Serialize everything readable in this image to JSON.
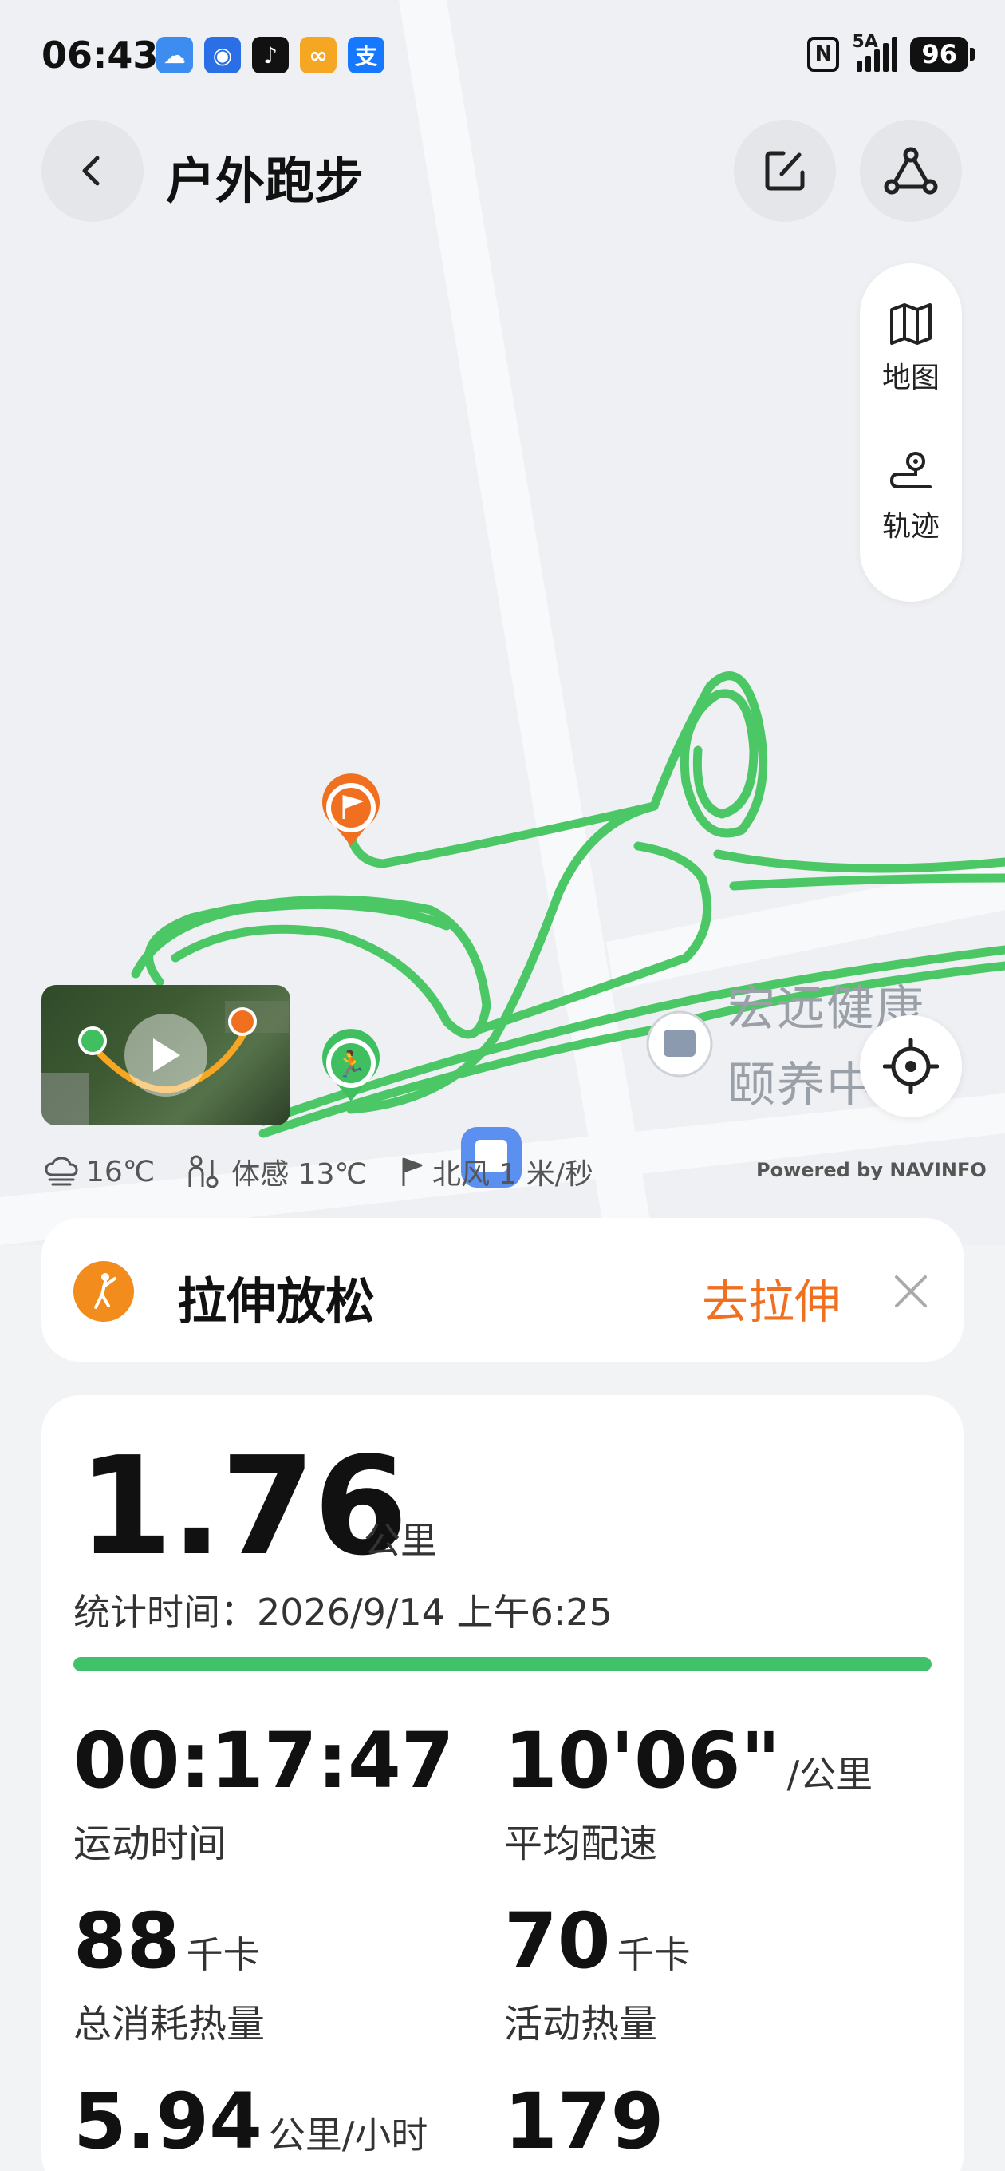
{
  "status_bar": {
    "time": "06:43",
    "network": "5A",
    "battery": "96",
    "apps": [
      {
        "name": "weather",
        "color": "#2f7de1",
        "glyph": "☁"
      },
      {
        "name": "lightbulb",
        "color": "#2f6fe8",
        "glyph": "💡"
      },
      {
        "name": "tiktok",
        "color": "#111111",
        "glyph": "♪"
      },
      {
        "name": "health",
        "color": "#f5a623",
        "glyph": "∞"
      },
      {
        "name": "alipay",
        "color": "#1677ff",
        "glyph": "支"
      }
    ]
  },
  "header": {
    "title": "户外跑步"
  },
  "side_panel": {
    "map_label": "地图",
    "track_label": "轨迹"
  },
  "map": {
    "poi_label_line1": "宏远健康",
    "poi_label_line2": "颐养中",
    "route_color": "#4cc766",
    "start_marker_color": "#3fbf5f",
    "end_marker_color": "#f07020"
  },
  "weather": {
    "temp": "16℃",
    "feels_like": "体感 13℃",
    "wind": "北风 1 米/秒",
    "powered_by": "Powered by NAVINFO"
  },
  "stretch": {
    "title": "拉伸放松",
    "action": "去拉伸"
  },
  "stats": {
    "distance": "1.76",
    "distance_unit": "公里",
    "time_label": "统计时间：",
    "time_value": "2026/9/14 上午6:25",
    "progress": 1.0,
    "duration": "00:17:47",
    "duration_label": "运动时间",
    "pace": "10'06\"",
    "pace_unit": "/公里",
    "pace_label": "平均配速",
    "total_kcal": "88",
    "total_kcal_unit": "千卡",
    "total_kcal_label": "总消耗热量",
    "active_kcal": "70",
    "active_kcal_unit": "千卡",
    "active_kcal_label": "活动热量",
    "speed": "5.94",
    "speed_unit": "公里/小时",
    "cadence": "179"
  }
}
